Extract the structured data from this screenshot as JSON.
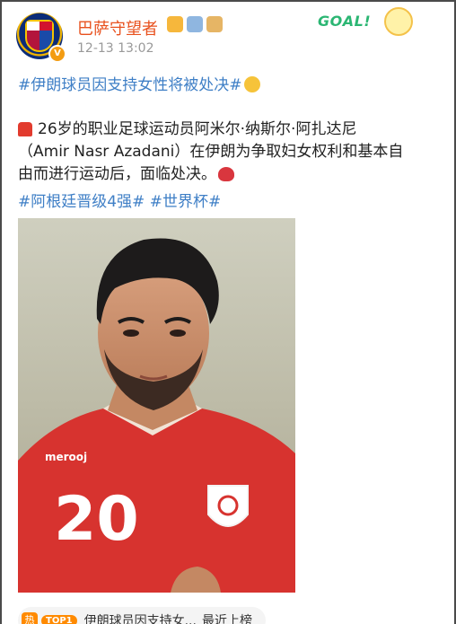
{
  "header": {
    "user_name": "巴萨守望者",
    "verified_mark": "V",
    "post_time": "12-13 13:02",
    "brand_logo_text": "GOAL!"
  },
  "post": {
    "title_hashtag": "#伊朗球员因支持女性将被处决#",
    "body_line_1": "26岁的职业足球运动员阿米尔·纳斯尔·阿扎达尼",
    "body_line_2": "（Amir Nasr Azadani）在伊朗为争取妇女权利和基本自",
    "body_line_3": "由而进行运动后，面临处决。",
    "hashtags": "#阿根廷晋级4强# #世界杯#"
  },
  "photo": {
    "jersey_number": "20",
    "jersey_brand": "merooj"
  },
  "trending": {
    "hot_icon_text": "热",
    "rank_badge": "TOP1",
    "title": "伊朗球员因支持女...",
    "status": "最近上榜"
  },
  "colors": {
    "username": "#e8511e",
    "link_blue": "#3f7fc6",
    "jersey_red": "#d7332f",
    "hot_orange": "#ff8a00"
  },
  "icons": {
    "emoji_after_title": "astonished-face",
    "emoji_before_body": "police-siren",
    "emoji_after_body": "broken-heart"
  }
}
